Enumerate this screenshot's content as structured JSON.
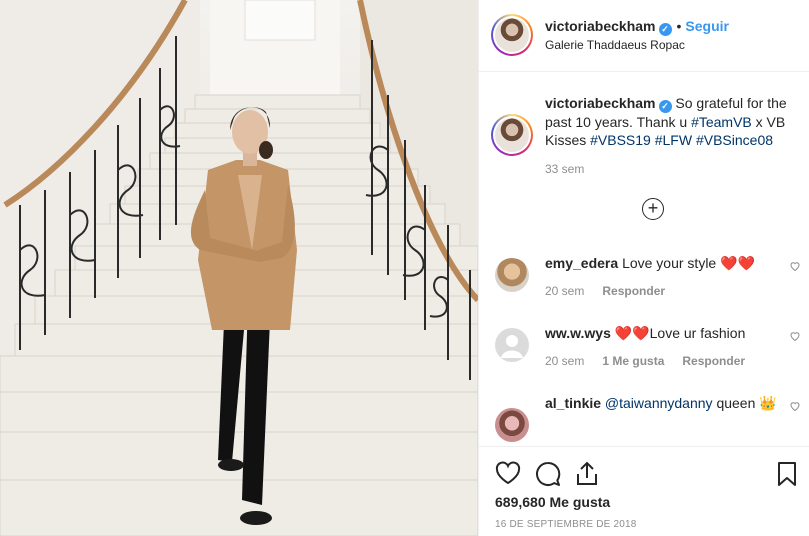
{
  "header": {
    "username": "victoriabeckham",
    "verified_mark": "✓",
    "separator": "•",
    "follow_label": "Seguir",
    "location": "Galerie Thaddaeus Ropac"
  },
  "caption": {
    "username": "victoriabeckham",
    "text_before": "So grateful for the past 10 years. Thank u",
    "tag_teamvb": "#TeamVB",
    "text_middle": "x VB Kisses",
    "tag_vbss19": "#VBSS19",
    "tag_lfw": "#LFW",
    "tag_vbsince08": "#VBSince08",
    "time": "33 sem"
  },
  "load_more_symbol": "+",
  "comments": [
    {
      "username": "emy_edera",
      "text": "Love your style ❤️❤️",
      "time": "20 sem",
      "likes": "",
      "reply": "Responder"
    },
    {
      "username": "ww.w.wys",
      "text": "❤️❤️Love ur fashion",
      "time": "20 sem",
      "likes": "1 Me gusta",
      "reply": "Responder"
    },
    {
      "username": "al_tinkie",
      "mention": "@taiwannydanny",
      "text": "queen 👑"
    }
  ],
  "footer": {
    "likes": "689,680 Me gusta",
    "date": "16 DE SEPTIEMBRE DE 2018"
  },
  "icons": {
    "heart": "heart-icon",
    "comment": "comment-icon",
    "share": "share-icon",
    "bookmark": "bookmark-icon"
  },
  "colors": {
    "link_blue": "#3897f0",
    "hashtag": "#003569",
    "muted": "#8e8e8e",
    "text": "#262626",
    "heart_red": "#ed4956"
  }
}
